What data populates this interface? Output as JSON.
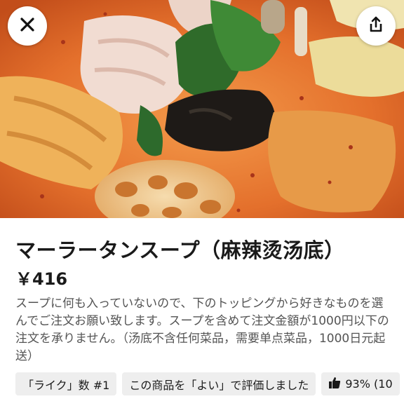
{
  "header": {
    "close_icon": "close-icon",
    "share_icon": "share-icon"
  },
  "item": {
    "title": "マーラータンスープ（麻辣烫汤底）",
    "price": "￥416",
    "description": "スープに何も入っていないので、下のトッピングから好きなものを選んでご注文お願い致します。スープを含めて注文金額が1000円以下の注文を承りません。（汤底不含任何菜品，需要单点菜品，1000日元起送）"
  },
  "chips": {
    "rank": "「ライク」数 #1",
    "rated": "この商品を「よい」で評価しました",
    "rating": "93% (10"
  },
  "colors": {
    "broth": "#e8722a",
    "background": "#ffffff",
    "chip_bg": "#eeeeee",
    "description_text": "#545454"
  }
}
